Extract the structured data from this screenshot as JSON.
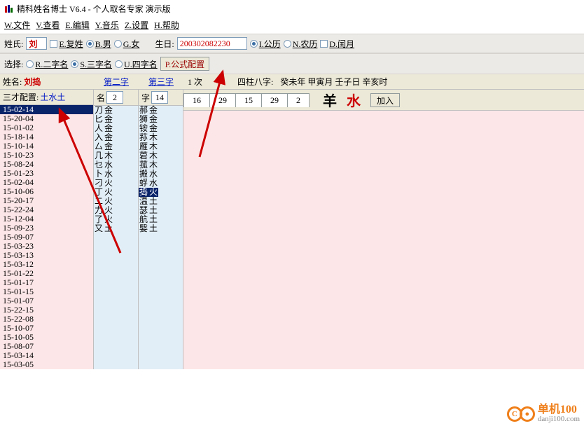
{
  "title": "精科姓名博士 V6.4 - 个人取名专家 演示版",
  "menu": [
    "W.文件",
    "V.查看",
    "E.编辑",
    "Y.音乐",
    "Z.设置",
    "H.帮助"
  ],
  "toolbar1": {
    "surname_label": "姓氏:",
    "surname_value": "刘",
    "double_surname": "E.复姓",
    "male": "B.男",
    "female": "G.女",
    "birth_label": "生日:",
    "birth_value": "200302082230",
    "solar": "I.公历",
    "lunar": "N.农历",
    "leap": "D.闰月"
  },
  "toolbar2": {
    "select_label": "选择:",
    "two_char": "R.二字名",
    "three_char": "S.三字名",
    "four_char": "U.四字名",
    "formula": "P.公式配置"
  },
  "col1": {
    "name_label": "姓名:",
    "name_value": "刘捣",
    "second": "第二字",
    "third": "第三字",
    "sancai_label": "三才配置:",
    "sancai_value": "土水土",
    "items": [
      "15-02-14",
      "15-20-04",
      "15-01-02",
      "15-18-14",
      "15-10-14",
      "15-10-23",
      "15-08-24",
      "15-01-23",
      "15-02-04",
      "15-10-06",
      "15-20-17",
      "15-22-24",
      "15-12-04",
      "15-09-23",
      "15-09-07",
      "15-03-23",
      "15-03-13",
      "15-03-12",
      "15-01-22",
      "15-01-17",
      "15-01-15",
      "15-01-07",
      "15-22-15",
      "15-22-08",
      "15-10-07",
      "15-10-05",
      "15-08-07",
      "15-03-14",
      "15-03-05"
    ]
  },
  "col2": {
    "label": "名",
    "num": "2",
    "items": [
      [
        "刀",
        "金"
      ],
      [
        "匕",
        "金"
      ],
      [
        "人",
        "金"
      ],
      [
        "入",
        "金"
      ],
      [
        "厶",
        "金"
      ],
      [
        "几",
        "木"
      ],
      [
        "乜",
        "水"
      ],
      [
        "卜",
        "水"
      ],
      [
        "刁",
        "火"
      ],
      [
        "丁",
        "火"
      ],
      [
        "二",
        "火"
      ],
      [
        "力",
        "火"
      ],
      [
        "了",
        "火"
      ],
      [
        "又",
        "土"
      ]
    ]
  },
  "col3": {
    "label": "字",
    "num": "14",
    "selected_index": 9,
    "items": [
      [
        "郝",
        "金"
      ],
      [
        "狮",
        "金"
      ],
      [
        "铵",
        "金"
      ],
      [
        "荪",
        "木"
      ],
      [
        "雁",
        "木"
      ],
      [
        "菪",
        "木"
      ],
      [
        "菰",
        "木"
      ],
      [
        "搬",
        "水"
      ],
      [
        "蜉",
        "水"
      ],
      [
        "捣",
        "火"
      ],
      [
        "温",
        "土"
      ],
      [
        "瑟",
        "土"
      ],
      [
        "航",
        "土"
      ],
      [
        "嫛",
        "土"
      ]
    ]
  },
  "right": {
    "times_prefix": "1",
    "times_suffix": "次",
    "bazi_label": "四柱八字:",
    "bazi": "癸未年 甲寅月 壬子日 辛亥时",
    "tabs": [
      "16",
      "29",
      "15",
      "29",
      "2"
    ],
    "animal": "羊",
    "element": "水",
    "add": "加入"
  },
  "logo": {
    "brand": "单机100",
    "domain": "danji100.com"
  }
}
